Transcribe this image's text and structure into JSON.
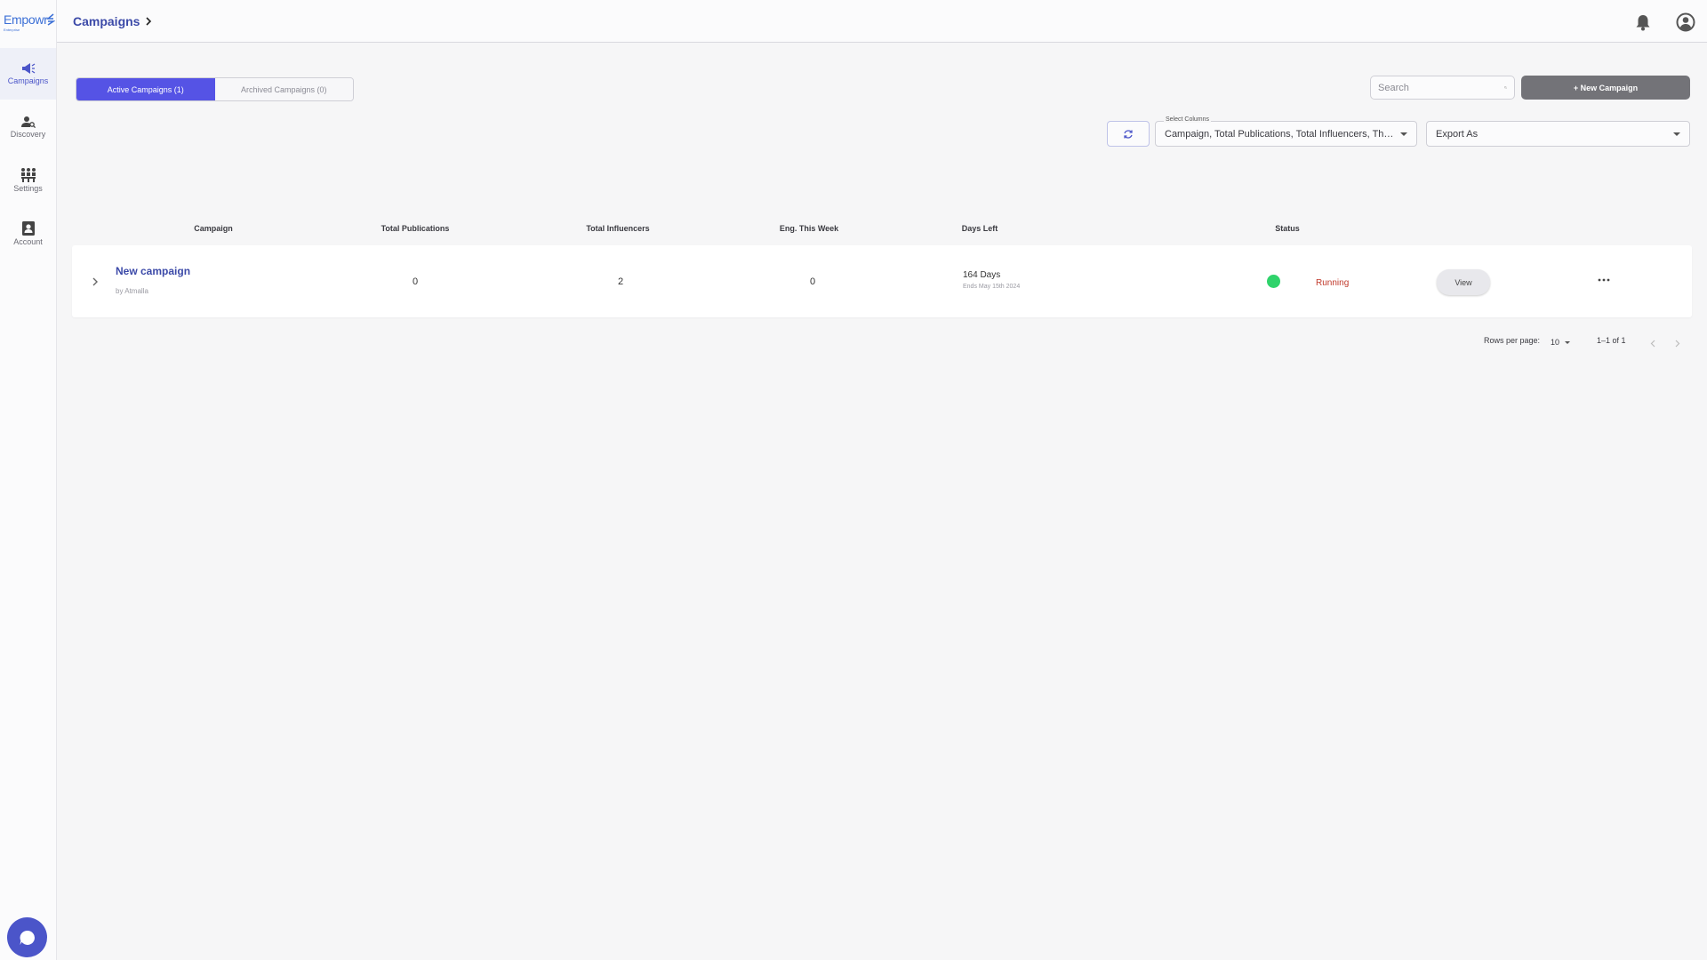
{
  "sidebar": {
    "logo": {
      "wordmark": "Empowr",
      "tagline": "Enterprise"
    },
    "items": [
      {
        "label": "Campaigns",
        "icon": "megaphone-icon",
        "active": true
      },
      {
        "label": "Discovery",
        "icon": "user-search-icon",
        "active": false
      },
      {
        "label": "Settings",
        "icon": "people-group-icon",
        "active": false
      },
      {
        "label": "Account",
        "icon": "account-card-icon",
        "active": false
      }
    ]
  },
  "header": {
    "breadcrumb": "Campaigns"
  },
  "tabs": [
    {
      "label": "Active Campaigns (1)",
      "active": true
    },
    {
      "label": "Archived Campaigns (0)",
      "active": false
    }
  ],
  "search": {
    "placeholder": "Search",
    "value": ""
  },
  "new_campaign_label": "+ New Campaign",
  "select_columns": {
    "label": "Select Columns",
    "value": "Campaign, Total Publications, Total Influencers, This ..."
  },
  "export": {
    "value": "Export As"
  },
  "table": {
    "headers": [
      "Campaign",
      "Total Publications",
      "Total Influencers",
      "Eng. This Week",
      "Days Left",
      "Status"
    ],
    "rows": [
      {
        "name": "New campaign",
        "owner": "by Atmalla",
        "total_publications": "0",
        "total_influencers": "2",
        "eng_this_week": "0",
        "days_left": "164 Days",
        "ends": "Ends May 15th 2024",
        "status": "Running",
        "view_label": "View"
      }
    ]
  },
  "pagination": {
    "rows_per_page_label": "Rows per page:",
    "rows_per_page": "10",
    "range": "1–1 of 1"
  },
  "colors": {
    "accent": "#5553e5",
    "brand": "#3c4aa8",
    "running": "#2fd36b",
    "status_text": "#c0392b"
  }
}
